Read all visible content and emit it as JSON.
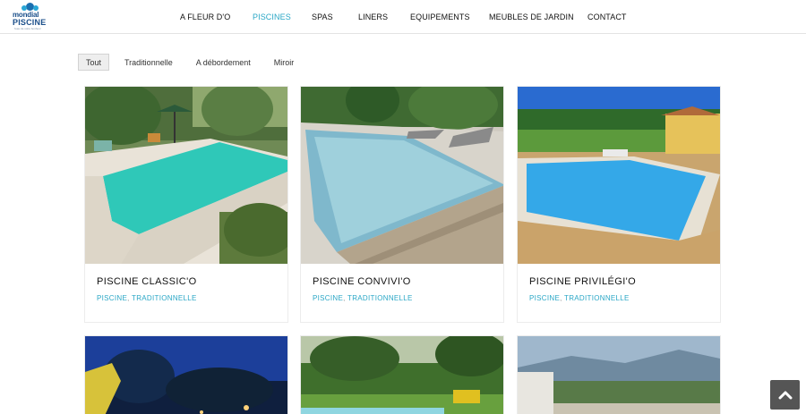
{
  "logo": {
    "line1": "mondial",
    "line2": "PISCINE",
    "tagline": "l'eau de votre bonheur"
  },
  "nav": [
    {
      "label": "A FLEUR D'O",
      "active": false
    },
    {
      "label": "PISCINES",
      "active": true
    },
    {
      "label": "SPAS",
      "active": false
    },
    {
      "label": "LINERS",
      "active": false
    },
    {
      "label": "EQUIPEMENTS",
      "active": false
    },
    {
      "label": "MEUBLES DE JARDIN",
      "active": false
    },
    {
      "label": "CONTACT",
      "active": false
    }
  ],
  "filters": [
    {
      "label": "Tout",
      "active": true
    },
    {
      "label": "Traditionnelle",
      "active": false
    },
    {
      "label": "A débordement",
      "active": false
    },
    {
      "label": "Miroir",
      "active": false
    }
  ],
  "products": [
    {
      "title": "PISCINE CLASSIC'O",
      "tag1": "PISCINE",
      "separator": ",",
      "tag2": "TRADITIONNELLE",
      "image": "pool-garden-sunny-photo"
    },
    {
      "title": "PISCINE CONVIVI'O",
      "tag1": "PISCINE",
      "separator": ",",
      "tag2": "TRADITIONNELLE",
      "image": "pool-wood-deck-loungers-photo"
    },
    {
      "title": "PISCINE PRIVILÉGI'O",
      "tag1": "PISCINE",
      "separator": ",",
      "tag2": "TRADITIONNELLE",
      "image": "pool-countryside-pool-house-photo"
    },
    {
      "image": "pool-night-lights-photo"
    },
    {
      "image": "pool-garden-bathers-photo"
    },
    {
      "image": "pool-mountain-view-photo"
    }
  ],
  "colors": {
    "accent": "#2aa7c6",
    "nav_text": "#111111",
    "totop_bg": "#555555"
  },
  "icons": {
    "back_to_top": "chevron-up-icon"
  }
}
